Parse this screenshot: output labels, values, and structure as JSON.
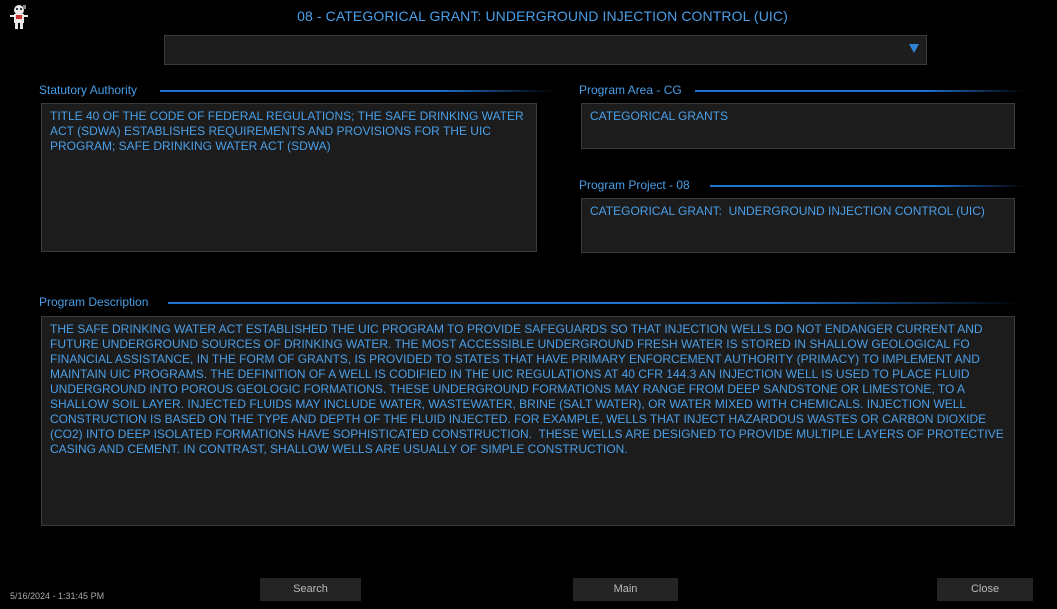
{
  "window": {
    "title": "08 - CATEGORICAL GRANT:  UNDERGROUND INJECTION CONTROL  (UIC)",
    "logo_icon": "mascot-logo-icon"
  },
  "selector": {
    "value": "",
    "icon": "chevron-down-icon"
  },
  "statutory_authority": {
    "label": "Statutory Authority",
    "text": "TITLE 40 OF THE CODE OF FEDERAL REGULATIONS; THE SAFE DRINKING WATER ACT (SDWA) ESTABLISHES REQUIREMENTS AND PROVISIONS FOR THE UIC PROGRAM; SAFE DRINKING WATER ACT (SDWA)"
  },
  "program_area": {
    "label": "Program Area - CG",
    "text": "CATEGORICAL GRANTS"
  },
  "program_project": {
    "label": "Program Project - 08",
    "text": "CATEGORICAL GRANT:  UNDERGROUND INJECTION CONTROL (UIC)"
  },
  "program_description": {
    "label": "Program Description",
    "text": "THE SAFE DRINKING WATER ACT ESTABLISHED THE UIC PROGRAM TO PROVIDE SAFEGUARDS SO THAT INJECTION WELLS DO NOT ENDANGER CURRENT AND FUTURE UNDERGROUND SOURCES OF DRINKING WATER. THE MOST ACCESSIBLE UNDERGROUND FRESH WATER IS STORED IN SHALLOW GEOLOGICAL FO FINANCIAL ASSISTANCE, IN THE FORM OF GRANTS, IS PROVIDED TO STATES THAT HAVE PRIMARY ENFORCEMENT AUTHORITY (PRIMACY) TO IMPLEMENT AND MAINTAIN UIC PROGRAMS. THE DEFINITION OF A WELL IS CODIFIED IN THE UIC REGULATIONS AT 40 CFR 144.3 AN INJECTION WELL IS USED TO PLACE FLUID UNDERGROUND INTO POROUS GEOLOGIC FORMATIONS. THESE UNDERGROUND FORMATIONS MAY RANGE FROM DEEP SANDSTONE OR LIMESTONE, TO A SHALLOW SOIL LAYER. INJECTED FLUIDS MAY INCLUDE WATER, WASTEWATER, BRINE (SALT WATER), OR WATER MIXED WITH CHEMICALS. INJECTION WELL CONSTRUCTION IS BASED ON THE TYPE AND DEPTH OF THE FLUID INJECTED. FOR EXAMPLE, WELLS THAT INJECT HAZARDOUS WASTES OR CARBON DIOXIDE (CO2) INTO DEEP ISOLATED FORMATIONS HAVE SOPHISTICATED CONSTRUCTION.  THESE WELLS ARE DESIGNED TO PROVIDE MULTIPLE LAYERS OF PROTECTIVE CASING AND CEMENT. IN CONTRAST, SHALLOW WELLS ARE USUALLY OF SIMPLE CONSTRUCTION."
  },
  "footer": {
    "timestamp": "5/16/2024 - 1:31:45 PM",
    "search_label": "Search",
    "main_label": "Main",
    "close_label": "Close"
  }
}
